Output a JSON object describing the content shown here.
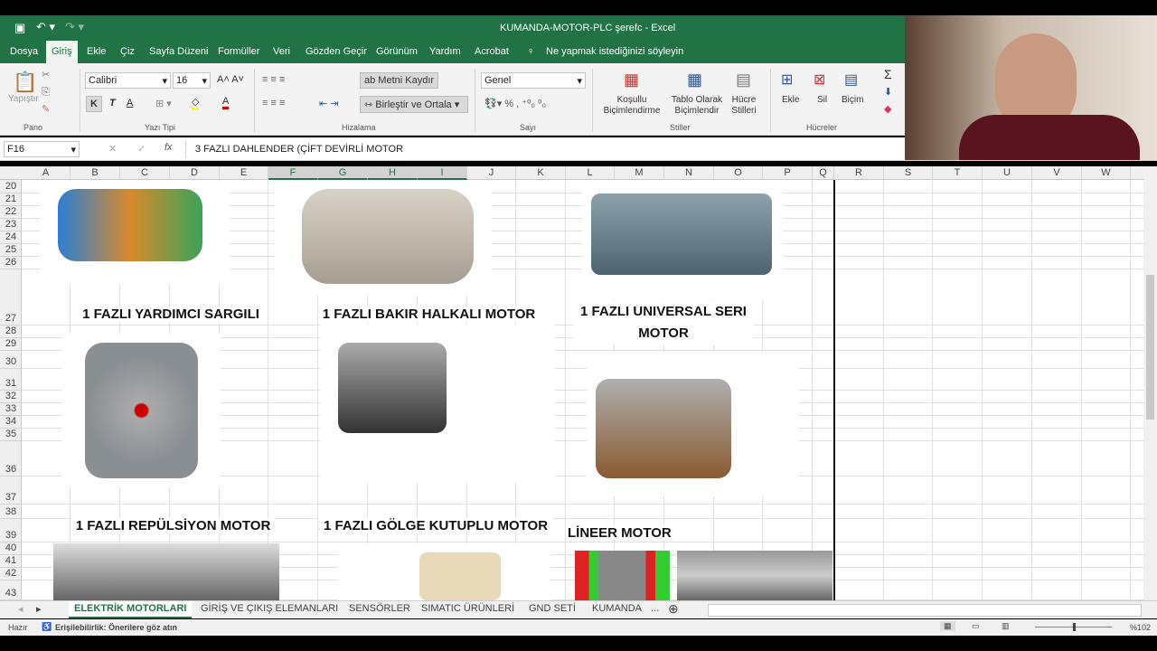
{
  "window": {
    "title": "KUMANDA-MOTOR-PLC şerefc  -  Excel"
  },
  "menu": [
    "Dosya",
    "Giriş",
    "Ekle",
    "Çiz",
    "Sayfa Düzeni",
    "Formüller",
    "Veri",
    "Gözden Geçir",
    "Görünüm",
    "Yardım",
    "Acrobat"
  ],
  "tell_me": "Ne yapmak istediğinizi söyleyin",
  "ribbon": {
    "paste": "Yapıştır",
    "font_name": "Calibri",
    "font_size": "16",
    "bold": "K",
    "italic": "T",
    "underline": "A",
    "wrap_text": "Metni Kaydır",
    "merge_center": "Birleştir ve Ortala",
    "number_format": "Genel",
    "cond_format": "Koşullu Biçimlendirme",
    "table_format": "Tablo Olarak Biçimlendir",
    "cell_styles": "Hücre Stilleri",
    "insert": "Ekle",
    "delete": "Sil",
    "format": "Biçim",
    "groups": [
      "Pano",
      "Yazı Tipi",
      "Hizalama",
      "Sayı",
      "Stiller",
      "Hücreler"
    ]
  },
  "name_box": "F16",
  "formula": "3 FAZLI DAHLENDER (ÇİFT DEVİRLİ MOTOR",
  "columns": [
    "A",
    "B",
    "C",
    "D",
    "E",
    "F",
    "G",
    "H",
    "I",
    "J",
    "K",
    "L",
    "M",
    "N",
    "O",
    "P",
    "Q",
    "R",
    "S",
    "T",
    "U",
    "V",
    "W"
  ],
  "rows": [
    "20",
    "21",
    "22",
    "23",
    "24",
    "25",
    "26",
    "27",
    "28",
    "29",
    "30",
    "31",
    "32",
    "33",
    "34",
    "35",
    "36",
    "37",
    "38",
    "39",
    "40",
    "41",
    "42",
    "43"
  ],
  "labels": {
    "l1": "1 FAZLI YARDIMCI SARGILI",
    "l2": "1 FAZLI BAKIR HALKALI MOTOR",
    "l3": "1 FAZLI UNIVERSAL SERI MOTOR",
    "l4": "1 FAZLI REPÜLSİYON MOTOR",
    "l5": "1 FAZLI GÖLGE KUTUPLU MOTOR",
    "l6": "LİNEER MOTOR"
  },
  "sheets": [
    "ELEKTRİK MOTORLARI",
    "GİRİŞ VE ÇIKIŞ ELEMANLARI",
    "SENSÖRLER",
    "SIMATIC ÜRÜNLERİ",
    "GND SETİ",
    "KUMANDA",
    "..."
  ],
  "status": {
    "ready": "Hazır",
    "accessibility": "Erişilebilirlik: Önerilere göz atın",
    "zoom": "%102"
  }
}
